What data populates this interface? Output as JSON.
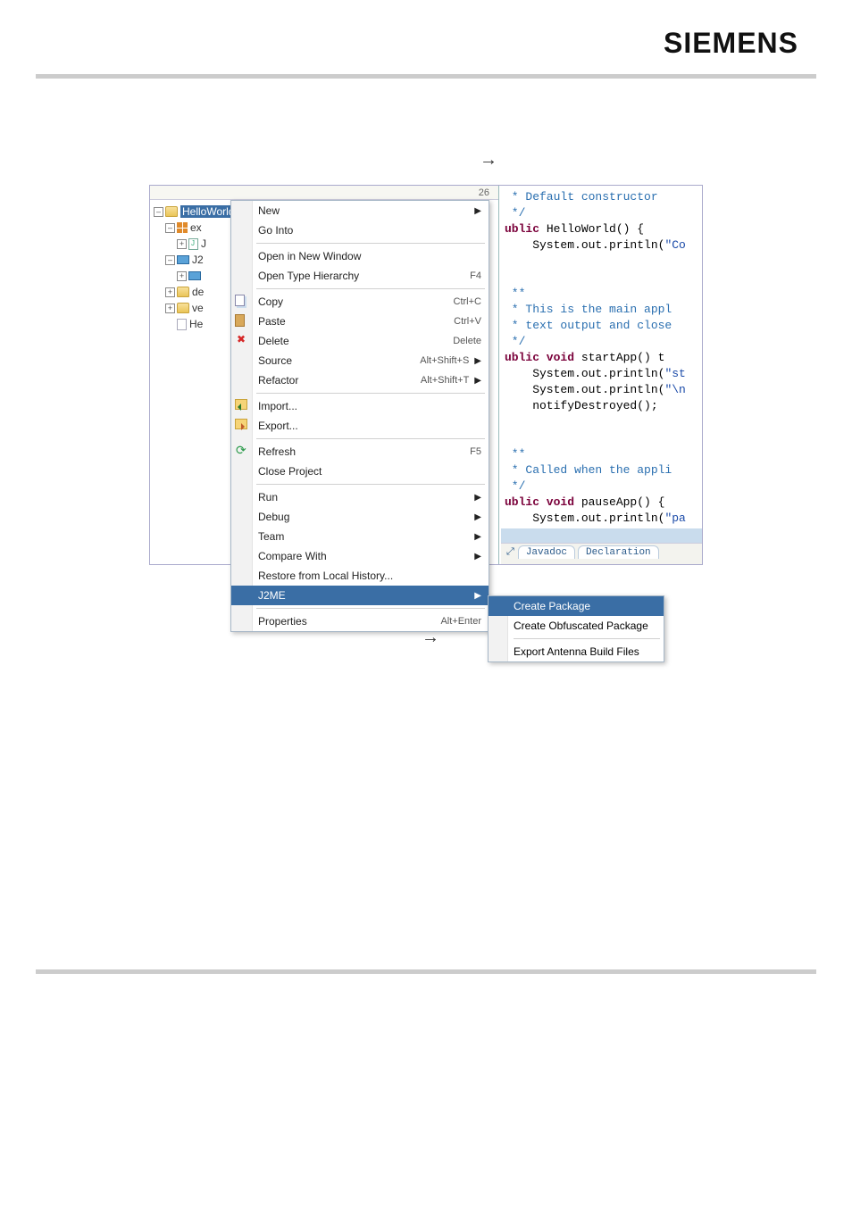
{
  "brand": "SIEMENS",
  "arrows": {
    "mid": "→",
    "bottom": "→"
  },
  "tree": {
    "root": "HelloWorld",
    "n_ex": "ex",
    "n_j": "J",
    "n_j2": "J2",
    "n_de": "de",
    "n_ve": "ve",
    "n_he": "He"
  },
  "ruler_value": "26",
  "menu": {
    "new": "New",
    "go_into": "Go Into",
    "open_new_window": "Open in New Window",
    "open_type_hierarchy": "Open Type Hierarchy",
    "open_type_hierarchy_sc": "F4",
    "copy": "Copy",
    "copy_sc": "Ctrl+C",
    "paste": "Paste",
    "paste_sc": "Ctrl+V",
    "delete": "Delete",
    "delete_sc": "Delete",
    "source": "Source",
    "source_sc": "Alt+Shift+S",
    "refactor": "Refactor",
    "refactor_sc": "Alt+Shift+T",
    "import": "Import...",
    "export": "Export...",
    "refresh": "Refresh",
    "refresh_sc": "F5",
    "close_project": "Close Project",
    "run": "Run",
    "debug": "Debug",
    "team": "Team",
    "compare_with": "Compare With",
    "restore_history": "Restore from Local History...",
    "j2me": "J2ME",
    "properties": "Properties",
    "properties_sc": "Alt+Enter"
  },
  "submenu": {
    "create_package": "Create Package",
    "create_obfuscated": "Create Obfuscated Package",
    "export_antenna": "Export Antenna Build Files"
  },
  "code": {
    "l1": " * Default constructor",
    "l2": " */",
    "l3a": "ublic",
    "l3b": " HelloWorld() {",
    "l4a": "    System.out.println(",
    "l4b": "\"Co",
    "l5": " **",
    "l6": " * This is the main appl",
    "l7": " * text output and close",
    "l8": " */",
    "l9a": "ublic void",
    "l9b": " startApp() t",
    "l10a": "    System.out.println(",
    "l10b": "\"st",
    "l11a": "    System.out.println(",
    "l11b": "\"\\n",
    "l12": "    notifyDestroyed();",
    "l13": " **",
    "l14": " * Called when the appli",
    "l15": " */",
    "l16a": "ublic void",
    "l16b": " pauseApp() {",
    "l17a": "    System.out.println(",
    "l17b": "\"pa"
  },
  "tabs": {
    "javadoc": "Javadoc",
    "declaration": "Declaration"
  }
}
